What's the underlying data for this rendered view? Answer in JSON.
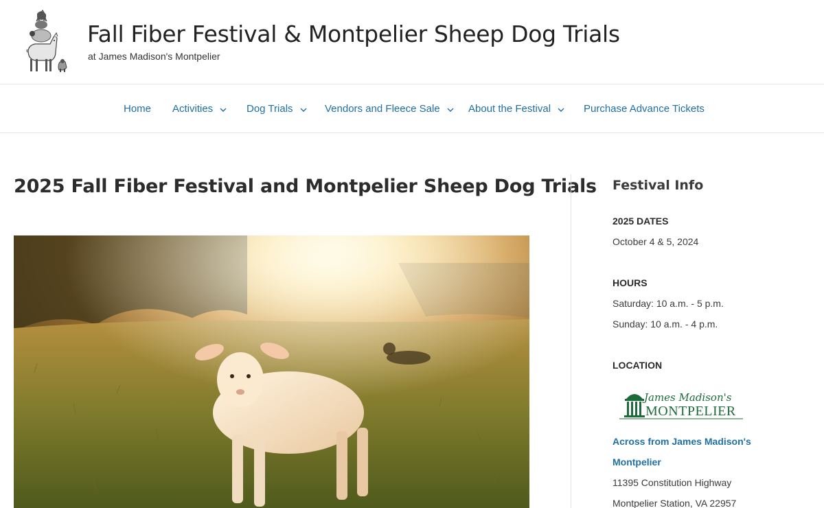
{
  "header": {
    "title": "Fall Fiber Festival & Montpelier Sheep Dog Trials",
    "tagline": "at James Madison's Montpelier",
    "logo_icon": "stacked-animals-logo-icon"
  },
  "nav": {
    "items": [
      {
        "label": "Home",
        "has_dropdown": false
      },
      {
        "label": "Activities",
        "has_dropdown": true
      },
      {
        "label": "Dog Trials",
        "has_dropdown": true
      },
      {
        "label": "Vendors and Fleece Sale",
        "has_dropdown": true
      },
      {
        "label": "About the Festival",
        "has_dropdown": true
      },
      {
        "label": "Purchase Advance Tickets",
        "has_dropdown": false
      }
    ],
    "link_color": "#1f6fa5"
  },
  "main": {
    "title": "2025 Fall Fiber Festival and Montpelier Sheep Dog Trials",
    "hero_image": "lamb-in-sunlit-field-photo"
  },
  "sidebar": {
    "widget_title": "Festival Info",
    "dates_heading": "2025 DATES",
    "dates_value": "October 4 & 5, 2024",
    "hours_heading": "HOURS",
    "hours_saturday": "Saturday: 10 a.m. - 5 p.m.",
    "hours_sunday": "Sunday: 10 a.m. - 4 p.m.",
    "location_heading": "LOCATION",
    "location_logo": {
      "script_text": "James Madison's",
      "caps_text": "MONTPELIER",
      "color": "#1d6b3a"
    },
    "location_link_line1": "Across from James Madison's",
    "location_link_line2": "Montpelier",
    "address_line1": "11395 Constitution Highway",
    "address_line2": "Montpelier Station, VA 22957"
  }
}
